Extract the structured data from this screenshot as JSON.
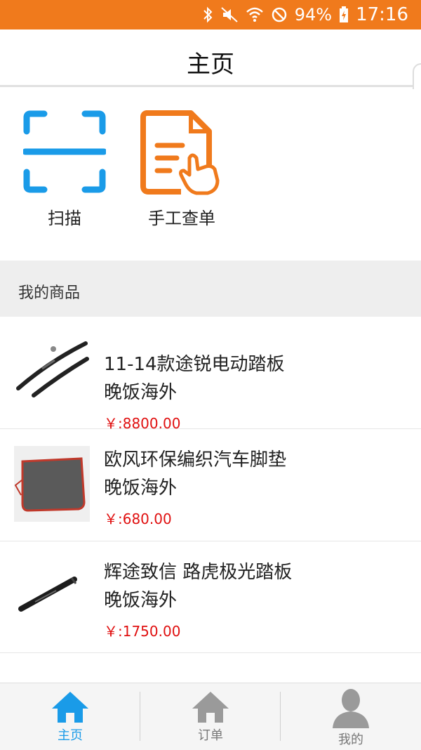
{
  "status_bar": {
    "battery": "94%",
    "time": "17:16",
    "icons": [
      "bluetooth-icon",
      "mute-icon",
      "wifi-icon",
      "do-not-disturb-icon",
      "battery-charging-icon"
    ]
  },
  "header": {
    "title": "主页"
  },
  "quick_actions": [
    {
      "label": "扫描",
      "icon": "scan-icon",
      "color": "#1a9be8"
    },
    {
      "label": "手工查单",
      "icon": "manual-lookup-icon",
      "color": "#f07a1c"
    }
  ],
  "section": {
    "title": "我的商品"
  },
  "products": [
    {
      "name_line1": "11-14款途锐电动踏板",
      "name_line2": "晚饭海外",
      "price": "￥:8800.00",
      "thumb": "wiper-blades-icon"
    },
    {
      "name_line1": "欧风环保编织汽车脚垫",
      "name_line2": "晚饭海外",
      "price": "￥:680.00",
      "thumb": "car-mat-icon"
    },
    {
      "name_line1": "辉途致信 路虎极光踏板",
      "name_line2": "晚饭海外",
      "price": "￥:1750.00",
      "thumb": "running-board-icon"
    }
  ],
  "tabs": [
    {
      "label": "主页",
      "icon": "home-icon",
      "active": true
    },
    {
      "label": "订单",
      "icon": "orders-home-icon",
      "active": false
    },
    {
      "label": "我的",
      "icon": "profile-icon",
      "active": false
    }
  ],
  "colors": {
    "accent": "#f07a1c",
    "active_tab": "#1a9be8",
    "inactive_tab": "#9a9a9a",
    "price": "#e01010"
  }
}
